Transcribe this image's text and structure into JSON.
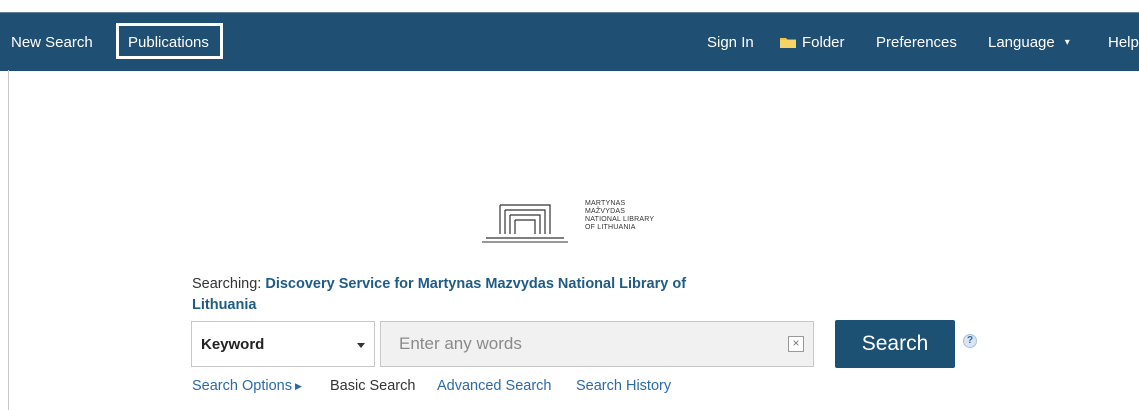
{
  "nav": {
    "new_search": "New Search",
    "publications": "Publications",
    "sign_in": "Sign In",
    "folder": "Folder",
    "preferences": "Preferences",
    "language": "Language",
    "help": "Help"
  },
  "icons": {
    "folder": "folder-icon",
    "language_caret": "chevron-down-icon",
    "select_caret": "caret-down-icon",
    "clear": "close-icon",
    "help": "question-icon",
    "search_options_arrow": "triangle-right-icon"
  },
  "logo": {
    "line1": "MARTYNAS",
    "line2": "MAŽVYDAS",
    "line3": "NATIONAL LIBRARY",
    "line4": "OF LITHUANIA"
  },
  "search": {
    "searching_label": "Searching:",
    "database": "Discovery Service for Martynas Mazvydas National Library of Lithuania",
    "field_select": "Keyword",
    "placeholder": "Enter any words",
    "button": "Search",
    "clear_symbol": "×",
    "help_symbol": "?"
  },
  "links": {
    "search_options": "Search Options",
    "basic_search": "Basic Search",
    "advanced_search": "Advanced Search",
    "search_history": "Search History"
  },
  "colors": {
    "topbar": "#1f4f72",
    "accent": "#1d5173",
    "link": "#2c6aa6",
    "folder": "#f5c542"
  }
}
